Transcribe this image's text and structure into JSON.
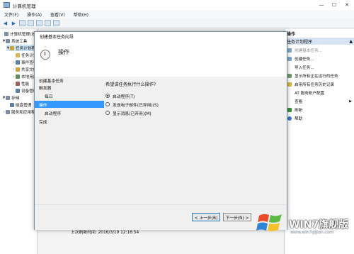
{
  "window": {
    "title": "计算机管理",
    "min": "—",
    "max": "☐",
    "close": "✕"
  },
  "menu": [
    "文件(F)",
    "操作(A)",
    "查看(V)",
    "帮助(H)"
  ],
  "tree": [
    {
      "label": "计算机管理(本地)",
      "arrow": "",
      "color": "#7b8da3"
    },
    {
      "label": "系统工具",
      "arrow": "▼",
      "color": "#7b8da3"
    },
    {
      "label": "任务计划程序",
      "arrow": "▼",
      "color": "#c9a63b"
    },
    {
      "label": "任务计划程序库",
      "arrow": "",
      "color": "#d7b65a"
    },
    {
      "label": "事件查看器",
      "arrow": "›",
      "color": "#5f7fa0"
    },
    {
      "label": "共享文件夹",
      "arrow": "›",
      "color": "#c9a63b"
    },
    {
      "label": "本地用户和组",
      "arrow": "›",
      "color": "#5f8c5f"
    },
    {
      "label": "性能",
      "arrow": "›",
      "color": "#a05f5f"
    },
    {
      "label": "设备管理器",
      "arrow": "",
      "color": "#5f7fa0"
    },
    {
      "label": "存储",
      "arrow": "▼",
      "color": "#7b8da3"
    },
    {
      "label": "磁盘管理",
      "arrow": "",
      "color": "#5f7fa0"
    },
    {
      "label": "服务和应用程序",
      "arrow": "›",
      "color": "#7b8da3"
    }
  ],
  "actions": {
    "header": "操作",
    "section": "任务计划程序",
    "items": [
      {
        "label": "创建基本任务...",
        "color": "#7fa7d1",
        "disabled": true
      },
      {
        "label": "创建任务...",
        "color": "#7fa7d1",
        "disabled": false
      },
      {
        "label": "导入任务...",
        "color": "#ffffff",
        "disabled": false
      },
      {
        "label": "显示所有正在运行的任务",
        "color": "#6f9f6f",
        "disabled": false
      },
      {
        "label": "启用所有任务历史记录",
        "color": "#d9b44a",
        "disabled": false
      },
      {
        "label": "AT 服务帐户配置",
        "color": "#ffffff",
        "disabled": false
      },
      {
        "label": "查看",
        "color": "#ffffff",
        "disabled": false,
        "arrow": "▶"
      },
      {
        "label": "刷新",
        "color": "#3d8e3d",
        "disabled": false
      },
      {
        "label": "帮助",
        "color": "#3a78c8",
        "disabled": false
      }
    ]
  },
  "status": {
    "last_refresh": "上次刷新时间: 2016/3/19 12:16:54"
  },
  "wizard": {
    "title": "创建基本任务向导",
    "heading": "操作",
    "steps": [
      {
        "label": "创建基本任务",
        "indent": false,
        "active": false
      },
      {
        "label": "触发器",
        "indent": false,
        "active": false
      },
      {
        "label": "每日",
        "indent": true,
        "active": false
      },
      {
        "label": "操作",
        "indent": false,
        "active": true
      },
      {
        "label": "启动程序",
        "indent": true,
        "active": false
      },
      {
        "label": "完成",
        "indent": false,
        "active": false
      }
    ],
    "question": "希望该任务执行什么操作?",
    "options": [
      {
        "label": "启动程序(T)",
        "selected": true
      },
      {
        "label": "发送电子邮件(已弃用)(S)",
        "selected": false
      },
      {
        "label": "显示消息(已弃用)(M)",
        "selected": false
      }
    ],
    "back_label": "< 上一步(B)",
    "next_label": "下一步(N) >"
  },
  "watermark": {
    "brand": "WIN7旗舰版",
    "url": "www.win7qijian.com"
  }
}
